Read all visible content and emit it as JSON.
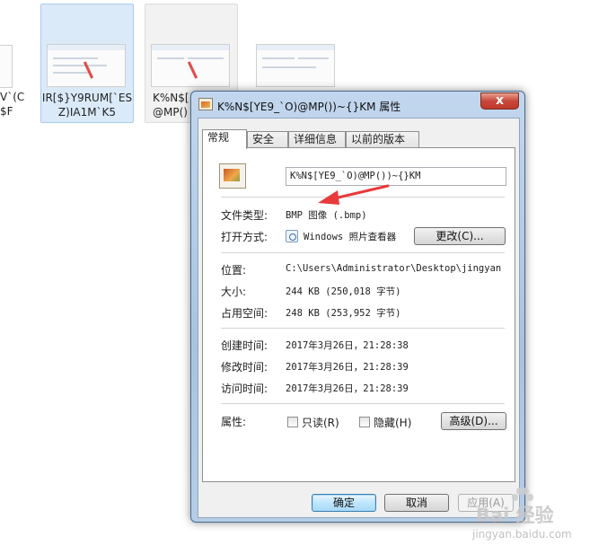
{
  "explorer": {
    "thumbnails": [
      {
        "caption_line1": "V`(C",
        "caption_line2": "$F"
      },
      {
        "caption_line1": "IR[$}Y9RUM[`ES",
        "caption_line2": "Z)IA1M`K5"
      },
      {
        "caption_line1": "K%N$[",
        "caption_line2": "@MP()"
      },
      {
        "caption_line1": "",
        "caption_line2": ""
      }
    ]
  },
  "dialog": {
    "title": "K%N$[YE9_`O)@MP())~{}KM 属性",
    "close_glyph": "x",
    "tabs": [
      "常规",
      "安全",
      "详细信息",
      "以前的版本"
    ],
    "general": {
      "file_name": "K%N$[YE9_`O)@MP())~{}KM",
      "file_type_label": "文件类型:",
      "file_type_value": "BMP 图像 (.bmp)",
      "open_with_label": "打开方式:",
      "open_with_value": "Windows 照片查看器",
      "change_button": "更改(C)...",
      "location_label": "位置:",
      "location_value": "C:\\Users\\Administrator\\Desktop\\jingyan",
      "size_label": "大小:",
      "size_value": "244 KB (250,018 字节)",
      "size_on_disk_label": "占用空间:",
      "size_on_disk_value": "248 KB (253,952 字节)",
      "created_label": "创建时间:",
      "created_value": "2017年3月26日，21:28:38",
      "modified_label": "修改时间:",
      "modified_value": "2017年3月26日，21:28:39",
      "accessed_label": "访问时间:",
      "accessed_value": "2017年3月26日，21:28:39",
      "attributes_label": "属性:",
      "readonly_label": "只读(R)",
      "readonly_checked": false,
      "hidden_label": "隐藏(H)",
      "hidden_checked": false,
      "advanced_button": "高级(D)..."
    },
    "buttons": {
      "ok": "确定",
      "cancel": "取消",
      "apply": "应用(A)"
    }
  },
  "watermark": {
    "main": "Bai 经验",
    "sub": "jingyan.baidu.com"
  },
  "colors": {
    "annotation_arrow": "#e83a3a",
    "title_bar": "#b4cce6",
    "close_button": "#c8473a"
  }
}
